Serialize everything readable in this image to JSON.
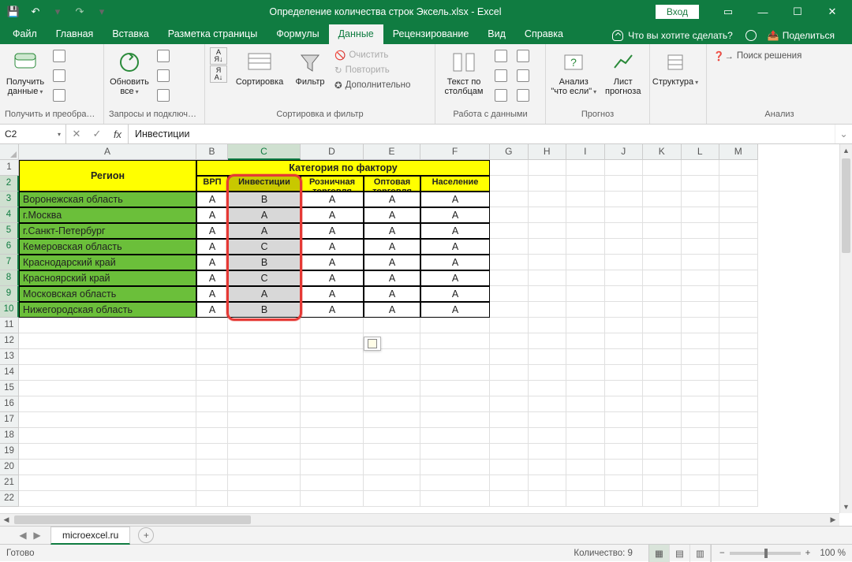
{
  "title_bar": {
    "filename": "Определение количества строк Эксель.xlsx  -  Excel",
    "login": "Вход"
  },
  "tabs": [
    "Файл",
    "Главная",
    "Вставка",
    "Разметка страницы",
    "Формулы",
    "Данные",
    "Рецензирование",
    "Вид",
    "Справка"
  ],
  "active_tab_index": 5,
  "tell_me": "Что вы хотите сделать?",
  "share": "Поделиться",
  "ribbon": {
    "group_get": {
      "big": "Получить данные",
      "label": "Получить и преобразова..."
    },
    "group_queries": {
      "big": "Обновить все",
      "label": "Запросы и подключе..."
    },
    "group_sort": {
      "sort": "Сортировка",
      "filter": "Фильтр",
      "clear": "Очистить",
      "reapply": "Повторить",
      "advanced": "Дополнительно",
      "label": "Сортировка и фильтр"
    },
    "group_datatools": {
      "big": "Текст по столбцам",
      "label": "Работа с данными"
    },
    "group_forecast": {
      "whatif": "Анализ \"что если\"",
      "forecast": "Лист прогноза",
      "label": "Прогноз"
    },
    "group_outline": {
      "big": "Структура",
      "label": ""
    },
    "group_analyze": {
      "solver": "Поиск решения",
      "label": "Анализ"
    }
  },
  "namebox": "C2",
  "formula": "Инвестиции",
  "columns": [
    "A",
    "B",
    "C",
    "D",
    "E",
    "F",
    "G",
    "H",
    "I",
    "J",
    "K",
    "L",
    "M"
  ],
  "selected_col": "C",
  "sel_rows": [
    2,
    3,
    4,
    5,
    6,
    7,
    8,
    9,
    10
  ],
  "table": {
    "category_header": "Категория по фактору",
    "region_header": "Регион",
    "cols": [
      "ВРП",
      "Инвестиции",
      "Розничная торговля",
      "Оптовая торговля",
      "Население"
    ],
    "rows": [
      {
        "region": "Воронежская область",
        "v": [
          "A",
          "B",
          "A",
          "A",
          "A"
        ]
      },
      {
        "region": "г.Москва",
        "v": [
          "A",
          "A",
          "A",
          "A",
          "A"
        ]
      },
      {
        "region": "г.Санкт-Петербург",
        "v": [
          "A",
          "A",
          "A",
          "A",
          "A"
        ]
      },
      {
        "region": "Кемеровская область",
        "v": [
          "A",
          "C",
          "A",
          "A",
          "A"
        ]
      },
      {
        "region": "Краснодарский край",
        "v": [
          "A",
          "B",
          "A",
          "A",
          "A"
        ]
      },
      {
        "region": "Красноярский край",
        "v": [
          "A",
          "C",
          "A",
          "A",
          "A"
        ]
      },
      {
        "region": "Московская область",
        "v": [
          "A",
          "A",
          "A",
          "A",
          "A"
        ]
      },
      {
        "region": "Нижегородская область",
        "v": [
          "A",
          "B",
          "A",
          "A",
          "A"
        ]
      }
    ]
  },
  "sheet_tab": "microexcel.ru",
  "status": {
    "ready": "Готово",
    "count": "Количество: 9",
    "zoom": "100 %"
  }
}
